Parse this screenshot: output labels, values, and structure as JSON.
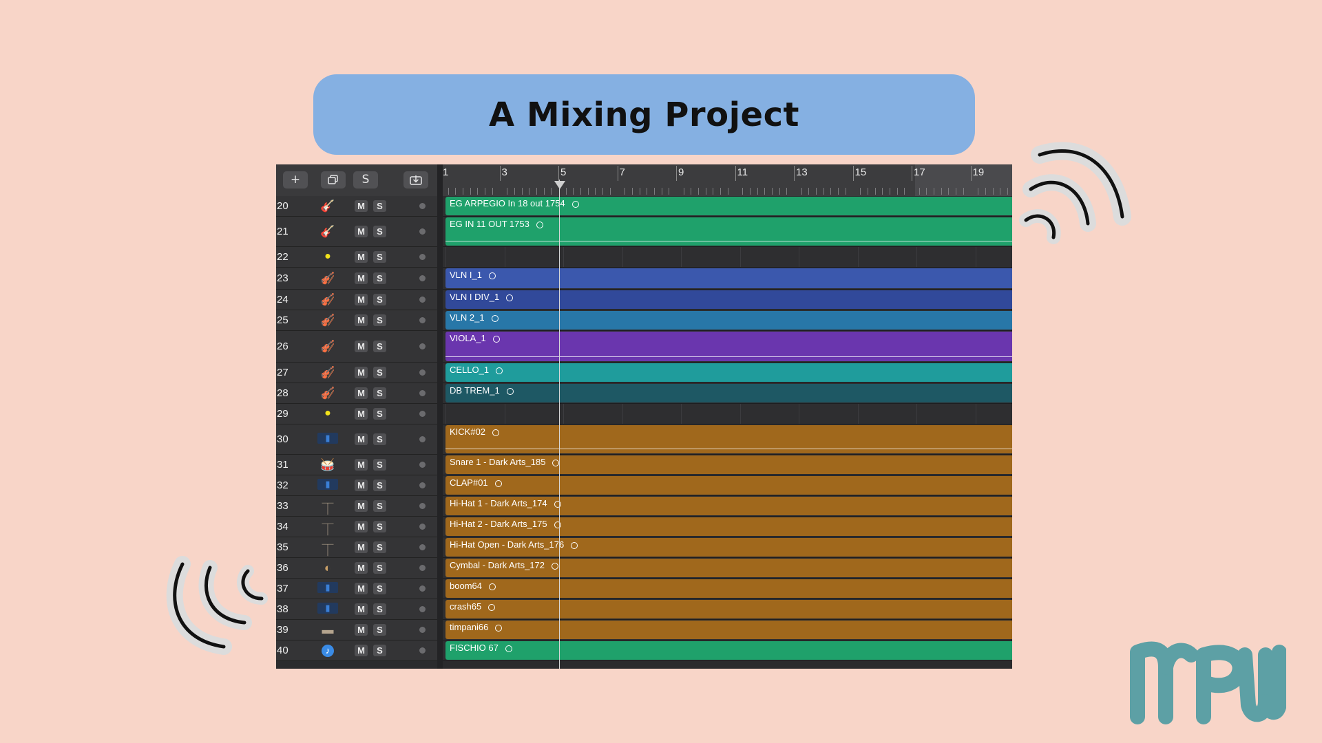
{
  "title": "A Mixing Project",
  "toolbar": {
    "add_label": "+",
    "s_label": "S"
  },
  "ruler": {
    "bars": [
      "1",
      "3",
      "5",
      "7",
      "9",
      "11",
      "13",
      "15",
      "17",
      "19"
    ]
  },
  "colors": {
    "green": "#1fa16b",
    "blue": "#3b58ad",
    "navy": "#31499a",
    "teal_blue": "#2877a8",
    "purple": "#6a36ae",
    "teal": "#1f9c9c",
    "dark_teal": "#1e5864",
    "orange": "#a0681c",
    "background": "#f8d5c8",
    "title_pill": "#85b0e2",
    "logo": "#5da0a5"
  },
  "tracks": [
    {
      "num": "20",
      "icon": "electric-guitar-icon",
      "glyph": "🎸",
      "m": "M",
      "s": "S",
      "region": "EG ARPEGIO In 18 out 1754",
      "color": "#1fa16b"
    },
    {
      "num": "21",
      "icon": "electric-guitar-icon",
      "glyph": "🎸",
      "m": "M",
      "s": "S",
      "region": "EG IN 11 OUT 1753",
      "color": "#1fa16b"
    },
    {
      "num": "22",
      "icon": "yellow-marker-icon",
      "glyph": "●",
      "m": "M",
      "s": "S",
      "region": "",
      "color": ""
    },
    {
      "num": "23",
      "icon": "violin-icon",
      "glyph": "🎻",
      "m": "M",
      "s": "S",
      "region": "VLN I_1",
      "color": "#3b58ad"
    },
    {
      "num": "24",
      "icon": "violin-icon",
      "glyph": "🎻",
      "m": "M",
      "s": "S",
      "region": "VLN I DIV_1",
      "color": "#31499a"
    },
    {
      "num": "25",
      "icon": "violin-icon",
      "glyph": "🎻",
      "m": "M",
      "s": "S",
      "region": "VLN 2_1",
      "color": "#2877a8"
    },
    {
      "num": "26",
      "icon": "string-section-icon",
      "glyph": "🎻",
      "m": "M",
      "s": "S",
      "region": "VIOLA_1",
      "color": "#6a36ae"
    },
    {
      "num": "27",
      "icon": "cello-icon",
      "glyph": "🎻",
      "m": "M",
      "s": "S",
      "region": "CELLO_1",
      "color": "#1f9c9c"
    },
    {
      "num": "28",
      "icon": "double-bass-icon",
      "glyph": "🎻",
      "m": "M",
      "s": "S",
      "region": "DB TREM_1",
      "color": "#1e5864"
    },
    {
      "num": "29",
      "icon": "yellow-marker-icon",
      "glyph": "●",
      "m": "M",
      "s": "S",
      "region": "",
      "color": ""
    },
    {
      "num": "30",
      "icon": "audio-waveform-icon",
      "glyph": "▮",
      "m": "M",
      "s": "S",
      "region": "KICK#02",
      "color": "#a0681c"
    },
    {
      "num": "31",
      "icon": "snare-drum-icon",
      "glyph": "🥁",
      "m": "M",
      "s": "S",
      "region": "Snare 1 - Dark Arts_185",
      "color": "#a0681c"
    },
    {
      "num": "32",
      "icon": "audio-waveform-icon",
      "glyph": "▮",
      "m": "M",
      "s": "S",
      "region": "CLAP#01",
      "color": "#a0681c"
    },
    {
      "num": "33",
      "icon": "hi-hat-icon",
      "glyph": "⏉",
      "m": "M",
      "s": "S",
      "region": "Hi-Hat 1 - Dark Arts_174",
      "color": "#a0681c"
    },
    {
      "num": "34",
      "icon": "hi-hat-icon",
      "glyph": "⏉",
      "m": "M",
      "s": "S",
      "region": "Hi-Hat 2 - Dark Arts_175",
      "color": "#a0681c"
    },
    {
      "num": "35",
      "icon": "hi-hat-icon",
      "glyph": "⏉",
      "m": "M",
      "s": "S",
      "region": "Hi-Hat Open - Dark Arts_176",
      "color": "#a0681c"
    },
    {
      "num": "36",
      "icon": "cymbal-icon",
      "glyph": "◐",
      "m": "M",
      "s": "S",
      "region": "Cymbal - Dark Arts_172",
      "color": "#a0681c"
    },
    {
      "num": "37",
      "icon": "audio-waveform-icon",
      "glyph": "▮",
      "m": "M",
      "s": "S",
      "region": "boom64",
      "color": "#a0681c"
    },
    {
      "num": "38",
      "icon": "audio-waveform-icon",
      "glyph": "▮",
      "m": "M",
      "s": "S",
      "region": "crash65",
      "color": "#a0681c"
    },
    {
      "num": "39",
      "icon": "timpani-icon",
      "glyph": "▬",
      "m": "M",
      "s": "S",
      "region": "timpani66",
      "color": "#a0681c"
    },
    {
      "num": "40",
      "icon": "music-note-icon",
      "glyph": "♪",
      "m": "M",
      "s": "S",
      "region": "FISCHIO 67",
      "color": "#1fa16b"
    }
  ]
}
